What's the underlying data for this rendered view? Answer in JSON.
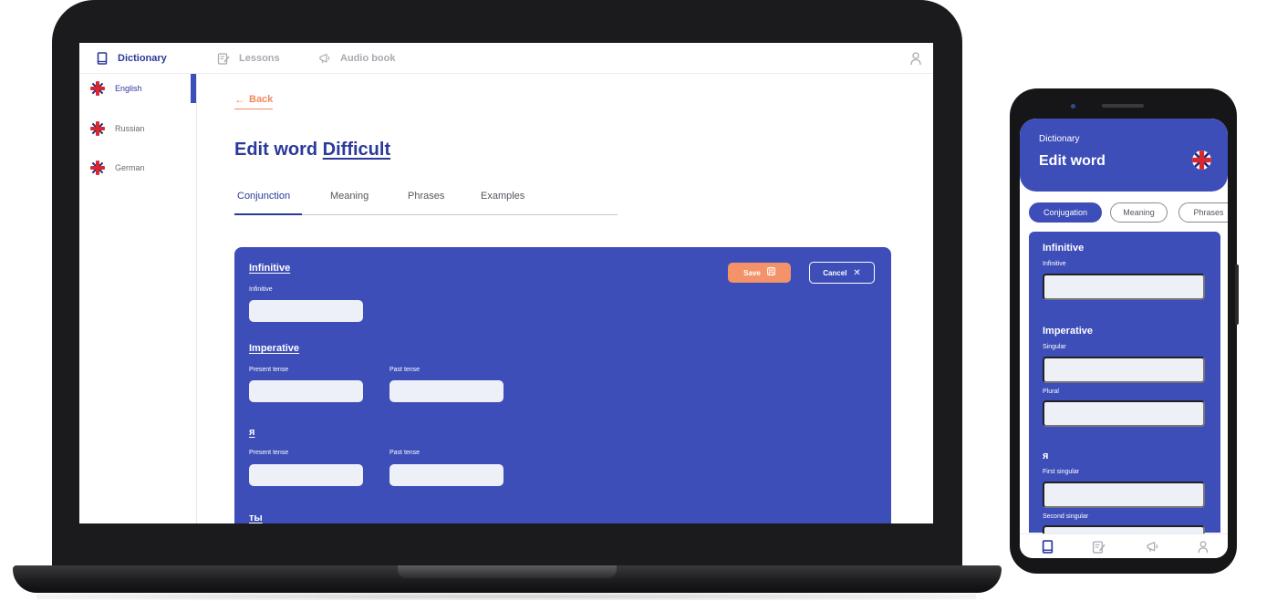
{
  "laptop": {
    "nav": {
      "dictionary": "Dictionary",
      "lessons": "Lessons",
      "audiobook": "Audio book"
    },
    "languages": [
      {
        "label": "English",
        "active": true
      },
      {
        "label": "Russian",
        "active": false
      },
      {
        "label": "German",
        "active": false
      }
    ],
    "back_label": "Back",
    "title_prefix": "Edit word",
    "title_word": "Difficult",
    "tabs": [
      "Conjunction",
      "Meaning",
      "Phrases",
      "Examples"
    ],
    "save_label": "Save",
    "cancel_label": "Cancel",
    "sections": {
      "infinitive_title": "Infinitive",
      "infinitive_label": "Infinitive",
      "imperative_title": "Imperative",
      "present_tense": "Present tense",
      "past_tense": "Past tense",
      "ya_title": "я",
      "ty_title": "ты"
    }
  },
  "phone": {
    "subtitle": "Dictionary",
    "title": "Edit word",
    "tabs": [
      "Conjugation",
      "Meaning",
      "Phrases"
    ],
    "infinitive_title": "Infinitive",
    "infinitive_label": "Infinitive",
    "imperative_title": "Imperative",
    "singular_label": "Singular",
    "plural_label": "Plural",
    "ya_title": "я",
    "first_singular_label": "First singular",
    "second_singular_label": "Second singular"
  },
  "colors": {
    "brand_blue": "#3d4eb8",
    "accent_orange": "#f4926a",
    "field_bg": "#eef0f8"
  }
}
